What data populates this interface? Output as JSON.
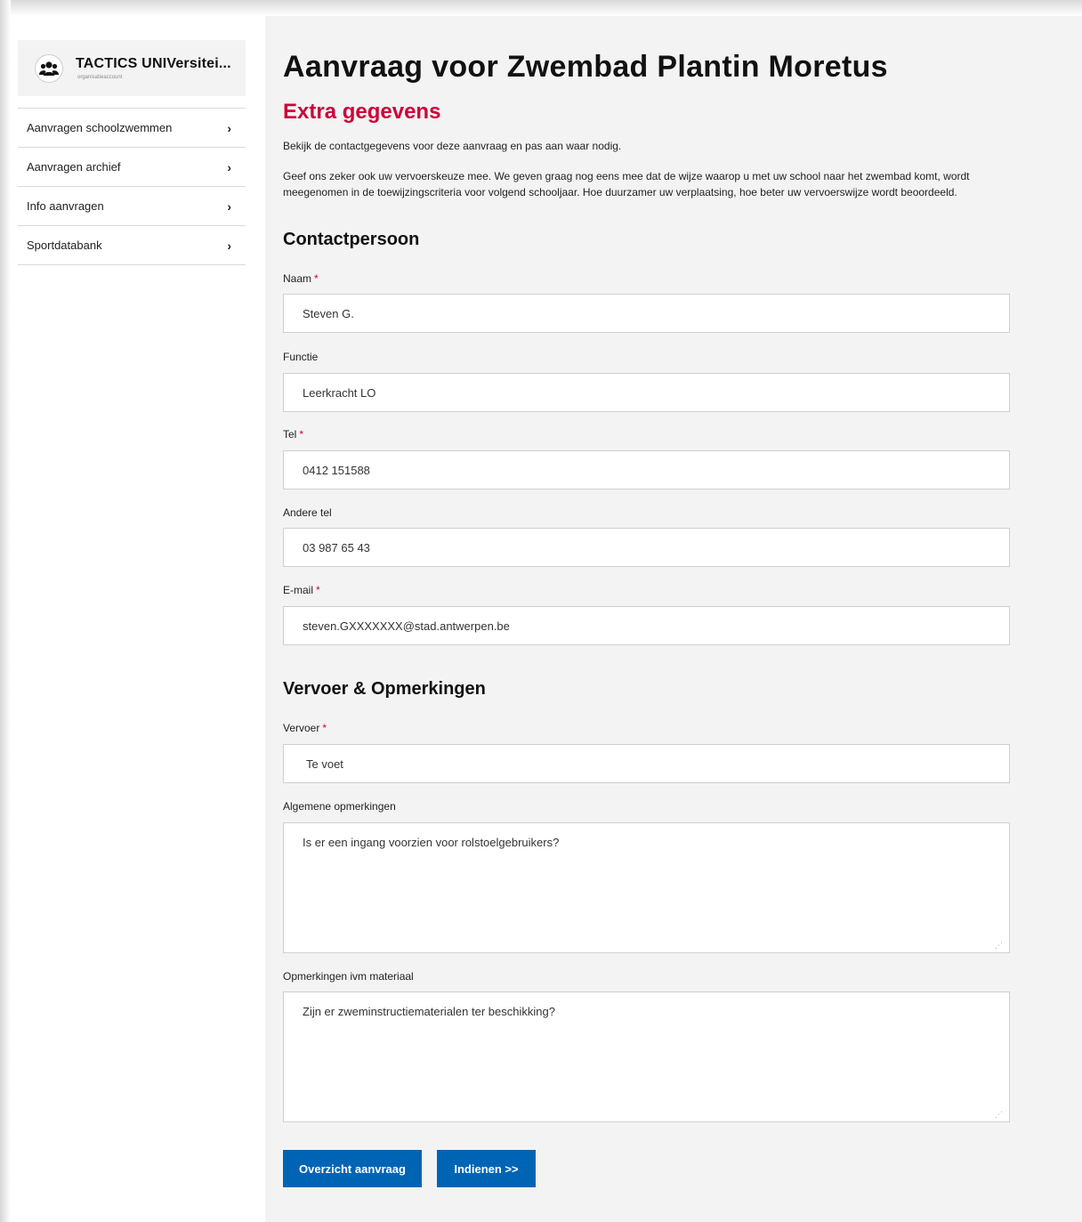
{
  "sidebar": {
    "org_name": "TACTICS UNIVersitei...",
    "org_type": "organisatieaccount",
    "items": [
      {
        "label": "Aanvragen schoolzwemmen"
      },
      {
        "label": "Aanvragen archief"
      },
      {
        "label": "Info aanvragen"
      },
      {
        "label": "Sportdatabank"
      }
    ]
  },
  "main": {
    "title": "Aanvraag voor Zwembad Plantin Moretus",
    "subtitle": "Extra gegevens",
    "intro_1": "Bekijk de contactgegevens voor deze aanvraag en pas aan waar nodig.",
    "intro_2": "Geef ons zeker ook uw vervoerskeuze mee. We geven graag nog eens mee dat de wijze waarop u met uw school naar het zwembad komt, wordt meegenomen in de toewijzingscriteria voor volgend schooljaar. Hoe duurzamer uw verplaatsing, hoe beter uw vervoerswijze wordt beoordeeld.",
    "contact": {
      "heading": "Contactpersoon",
      "naam_label": "Naam",
      "naam_value": "Steven G.",
      "functie_label": "Functie",
      "functie_value": "Leerkracht LO",
      "tel_label": "Tel",
      "tel_value": "0412 151588",
      "andere_tel_label": "Andere tel",
      "andere_tel_value": "03 987 65 43",
      "email_label": "E-mail",
      "email_value": "steven.GXXXXXXX@stad.antwerpen.be",
      "required_marker": "*"
    },
    "transport": {
      "heading": "Vervoer & Opmerkingen",
      "vervoer_label": "Vervoer",
      "vervoer_value": "Te voet",
      "algemene_label": "Algemene opmerkingen",
      "algemene_value": "Is er een ingang voorzien voor rolstoelgebruikers?",
      "materiaal_label": "Opmerkingen ivm materiaal",
      "materiaal_value": "Zijn er zweminstructiematerialen ter beschikking?"
    },
    "buttons": {
      "overview": "Overzicht aanvraag",
      "submit": "Indienen >>"
    }
  },
  "colors": {
    "accent_red": "#cf0039",
    "button_blue": "#0064b4",
    "content_bg": "#f3f3f4"
  },
  "icons": {
    "org_avatar": "users-icon",
    "nav_chevron": "chevron-right-icon"
  }
}
